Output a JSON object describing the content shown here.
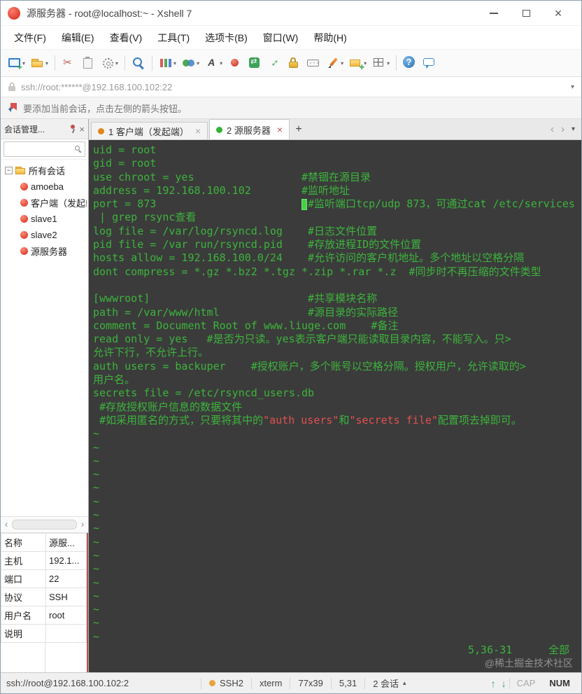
{
  "window": {
    "title": "源服务器 - root@localhost:~ - Xshell 7"
  },
  "menu": {
    "items": [
      "文件(F)",
      "编辑(E)",
      "查看(V)",
      "工具(T)",
      "选项卡(B)",
      "窗口(W)",
      "帮助(H)"
    ]
  },
  "toolbar": {
    "icons": [
      {
        "name": "new-session-icon",
        "kind": "monitor",
        "dropdown": true
      },
      {
        "name": "open-folder-icon",
        "kind": "folder",
        "dropdown": true
      },
      {
        "name": "separator"
      },
      {
        "name": "disconnect-icon",
        "kind": "scissors"
      },
      {
        "name": "paste-icon",
        "kind": "clipboard"
      },
      {
        "name": "properties-icon",
        "kind": "gear",
        "dropdown": true
      },
      {
        "name": "separator"
      },
      {
        "name": "find-icon",
        "kind": "magnifier"
      },
      {
        "name": "separator"
      },
      {
        "name": "color-scheme-icon",
        "kind": "bars",
        "dropdown": true
      },
      {
        "name": "appearance-icon",
        "kind": "circles",
        "dropdown": true
      },
      {
        "name": "font-icon",
        "kind": "font",
        "dropdown": true
      },
      {
        "name": "record-icon",
        "kind": "record"
      },
      {
        "name": "transfer-icon",
        "kind": "transfer"
      },
      {
        "name": "fullscreen-icon",
        "kind": "fullscreen"
      },
      {
        "name": "lock-screen-icon",
        "kind": "lock"
      },
      {
        "name": "keyboard-icon",
        "kind": "keyboard"
      },
      {
        "name": "highlight-pen-icon",
        "kind": "pen",
        "dropdown": true
      },
      {
        "name": "new-folder-icon",
        "kind": "folderplus",
        "dropdown": true
      },
      {
        "name": "layout-icon",
        "kind": "grid",
        "dropdown": true
      },
      {
        "name": "separator"
      },
      {
        "name": "help-icon",
        "kind": "help"
      },
      {
        "name": "feedback-icon",
        "kind": "bubble"
      }
    ]
  },
  "address_bar": {
    "value": "ssh://root:******@192.168.100.102:22"
  },
  "info_bar": {
    "text": "要添加当前会话，点击左侧的箭头按钮。"
  },
  "session_panel": {
    "title": "会话管理...",
    "root": "所有会话",
    "sessions": [
      "amoeba",
      "客户端（发起端）",
      "slave1",
      "slave2",
      "源服务器"
    ],
    "properties": [
      {
        "label": "名称",
        "value": "源服..."
      },
      {
        "label": "主机",
        "value": "192.1..."
      },
      {
        "label": "端口",
        "value": "22"
      },
      {
        "label": "协议",
        "value": "SSH"
      },
      {
        "label": "用户名",
        "value": "root"
      },
      {
        "label": "说明",
        "value": ""
      }
    ]
  },
  "tabs": {
    "items": [
      {
        "label": "1 客户端（发起端）",
        "active": false,
        "status": "inactive"
      },
      {
        "label": "2 源服务器",
        "active": true,
        "status": "connected"
      }
    ]
  },
  "terminal": {
    "colors": {
      "background": "#3b3b3b",
      "foreground": "#3cb43c",
      "highlight": "#e25050"
    },
    "lines": [
      [
        {
          "t": "uid = root"
        }
      ],
      [
        {
          "t": "gid = root"
        }
      ],
      [
        {
          "t": "use chroot = yes                 #禁锢在源目录"
        }
      ],
      [
        {
          "t": "address = 192.168.100.102        #监听地址"
        }
      ],
      [
        {
          "t": "port = 873                       "
        },
        {
          "cursor": true
        },
        {
          "t": "#监听端口tcp/udp 873，可通过cat /etc/services"
        }
      ],
      [
        {
          "t": " | grep rsync查看"
        }
      ],
      [
        {
          "t": "log file = /var/log/rsyncd.log    #日志文件位置"
        }
      ],
      [
        {
          "t": "pid file = /var run/rsyncd.pid    #存放进程ID的文件位置"
        }
      ],
      [
        {
          "t": "hosts allow = 192.168.100.0/24    #允许访问的客户机地址。多个地址以空格分隔"
        }
      ],
      [
        {
          "t": "dont compress = *.gz *.bz2 *.tgz *.zip *.rar *.z  #同步时不再压缩的文件类型"
        }
      ],
      [
        {
          "t": ""
        }
      ],
      [
        {
          "t": "[wwwroot]                         #共享模块名称"
        }
      ],
      [
        {
          "t": "path = /var/www/html              #源目录的实际路径"
        }
      ],
      [
        {
          "t": "comment = Document Root of www.liuge.com    #备注"
        }
      ],
      [
        {
          "t": "read only = yes   #是否为只读。yes表示客户端只能读取目录内容，不能写入。只>"
        }
      ],
      [
        {
          "t": "允许下行，不允许上行。"
        }
      ],
      [
        {
          "t": "auth users = backuper    #授权账户，多个账号以空格分隔。授权用户，允许读取的>"
        }
      ],
      [
        {
          "t": "用户名。"
        }
      ],
      [
        {
          "t": "secrets file = /etc/rsyncd_users.db"
        }
      ],
      [
        {
          "t": " #存放授权账户信息的数据文件"
        }
      ],
      [
        {
          "t": " #如采用匿名的方式，只要将其中的"
        },
        {
          "t": "\"auth users\"",
          "c": "r"
        },
        {
          "t": "和"
        },
        {
          "t": "\"secrets file\"",
          "c": "r"
        },
        {
          "t": "配置项去掉即可。"
        }
      ],
      [
        {
          "t": "~"
        }
      ],
      [
        {
          "t": "~"
        }
      ],
      [
        {
          "t": "~"
        }
      ],
      [
        {
          "t": "~"
        }
      ],
      [
        {
          "t": "~"
        }
      ],
      [
        {
          "t": "~"
        }
      ],
      [
        {
          "t": "~"
        }
      ],
      [
        {
          "t": "~"
        }
      ],
      [
        {
          "t": "~"
        }
      ],
      [
        {
          "t": "~"
        }
      ],
      [
        {
          "t": "~"
        }
      ],
      [
        {
          "t": "~"
        }
      ],
      [
        {
          "t": "~"
        }
      ],
      [
        {
          "t": "~"
        }
      ],
      [
        {
          "t": "~"
        }
      ],
      [
        {
          "t": "~"
        }
      ]
    ],
    "ruler": {
      "position": "5,36-31",
      "scroll": "全部"
    },
    "watermark": "@稀土掘金技术社区"
  },
  "status_bar": {
    "connection": "ssh://root@192.168.100.102:2",
    "protocol": "SSH2",
    "terminal_type": "xterm",
    "screen_size": "77x39",
    "cursor_position": "5,31",
    "session_count": "2 会话",
    "caps": "CAP",
    "num": "NUM"
  }
}
